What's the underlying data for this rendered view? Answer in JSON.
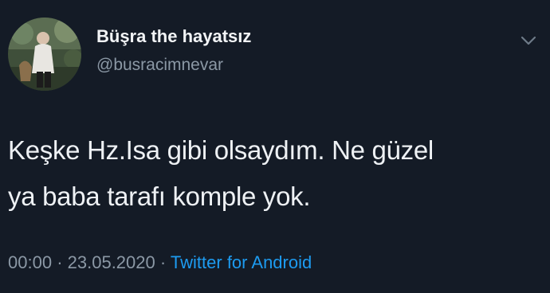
{
  "tweet": {
    "author": {
      "display_name": "Büşra the hayatsız",
      "handle": "@busracimnevar",
      "avatar_icon": "profile-photo"
    },
    "menu_icon": "chevron-down-icon",
    "text": "Keşke Hz.Isa gibi olsaydım. Ne güzel\nya baba tarafı komple yok.",
    "time": "00:00",
    "separator": "·",
    "date": "23.05.2020",
    "source": "Twitter for Android"
  },
  "colors": {
    "background": "#141b26",
    "text": "#eef1f4",
    "secondary": "#8b98a5",
    "link": "#1d9bf0"
  }
}
